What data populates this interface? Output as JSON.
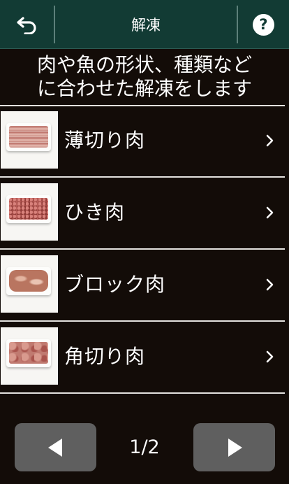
{
  "header": {
    "title": "解凍",
    "back_icon": "back-arrow-icon",
    "help_label": "?",
    "background": "#123b34"
  },
  "description": {
    "line1": "肉や魚の形状、種類など",
    "line2": "に合わせた解凍をします"
  },
  "items": [
    {
      "label": "薄切り肉",
      "icon": "thin-sliced-meat-icon"
    },
    {
      "label": "ひき肉",
      "icon": "ground-meat-icon"
    },
    {
      "label": "ブロック肉",
      "icon": "block-meat-icon"
    },
    {
      "label": "角切り肉",
      "icon": "cubed-meat-icon"
    }
  ],
  "pagination": {
    "page_text": "1/2",
    "current": 1,
    "total": 2,
    "prev_icon": "triangle-left-icon",
    "next_icon": "triangle-right-icon",
    "button_color": "#5f5f5f"
  }
}
